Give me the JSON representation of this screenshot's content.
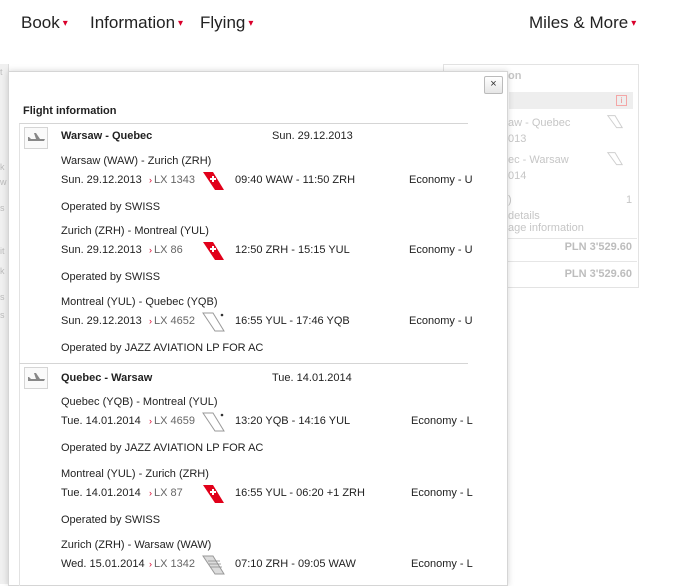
{
  "nav": {
    "items": [
      {
        "label": "Book"
      },
      {
        "label": "Information"
      },
      {
        "label": "Flying"
      },
      {
        "label": "Miles & More"
      }
    ],
    "chevron": "▾"
  },
  "background": {
    "right_panel": {
      "heading": "on",
      "info": "i",
      "route1": "aw - Quebec",
      "route1_sub": "013",
      "route2": "ec - Warsaw",
      "route2_sub": "014",
      "count_left": ")",
      "count_right": "1",
      "details": "details",
      "baggage": "age information",
      "price1": "PLN 3'529.60",
      "price2": "PLN 3'529.60"
    },
    "left_marks": [
      "t",
      "k",
      "w",
      "s",
      "it",
      "k",
      "s",
      "s"
    ]
  },
  "popup": {
    "close": "×",
    "title": "Flight information",
    "colors": {
      "accent": "#d9002b",
      "swiss_red": "#e1001a"
    },
    "sections": [
      {
        "route": "Warsaw - Quebec",
        "date": "Sun. 29.12.2013",
        "icon": "plane-outbound-icon",
        "legs": [
          {
            "route": "Warsaw (WAW) - Zurich (ZRH)",
            "date": "Sun. 29.12.2013",
            "flight": "LX 1343",
            "tail": "swiss",
            "times": "09:40 WAW - 11:50 ZRH",
            "cabin": "Economy - U",
            "operated": "Operated by SWISS"
          },
          {
            "route": "Zurich (ZRH) - Montreal (YUL)",
            "date": "Sun. 29.12.2013",
            "flight": "LX 86",
            "tail": "swiss",
            "times": "12:50 ZRH - 15:15 YUL",
            "cabin": "Economy - U",
            "operated": "Operated by SWISS"
          },
          {
            "route": "Montreal (YUL) - Quebec (YQB)",
            "date": "Sun. 29.12.2013",
            "flight": "LX 4652",
            "tail": "partner",
            "times": "16:55 YUL - 17:46 YQB",
            "cabin": "Economy - U",
            "operated": "Operated by JAZZ AVIATION LP FOR AC"
          }
        ]
      },
      {
        "route": "Quebec - Warsaw",
        "date": "Tue. 14.01.2014",
        "icon": "plane-return-icon",
        "legs": [
          {
            "route": "Quebec (YQB) - Montreal (YUL)",
            "date": "Tue. 14.01.2014",
            "flight": "LX 4659",
            "tail": "partner",
            "times": "13:20 YQB - 14:16 YUL",
            "cabin": "Economy - L",
            "operated": "Operated by JAZZ AVIATION LP FOR AC"
          },
          {
            "route": "Montreal (YUL) - Zurich (ZRH)",
            "date": "Tue. 14.01.2014",
            "flight": "LX 87",
            "tail": "swiss",
            "times": "16:55 YUL - 06:20 +1 ZRH",
            "cabin": "Economy - L",
            "operated": "Operated by SWISS"
          },
          {
            "route": "Zurich (ZRH) - Warsaw (WAW)",
            "date": "Wed. 15.01.2014",
            "flight": "LX 1342",
            "tail": "lot",
            "times": "07:10 ZRH - 09:05 WAW",
            "cabin": "Economy - L",
            "operated": ""
          }
        ]
      }
    ]
  }
}
